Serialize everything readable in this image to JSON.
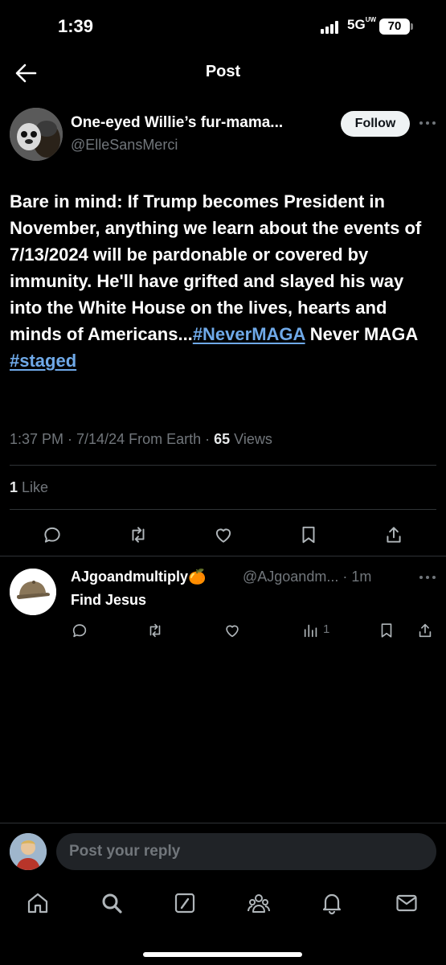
{
  "status_bar": {
    "time": "1:39",
    "network": "5G",
    "network_sup": "UW",
    "battery": "70"
  },
  "header": {
    "title": "Post"
  },
  "post": {
    "author_name": "One-eyed Willie’s fur-mama...",
    "author_handle": "@ElleSansMerci",
    "follow_label": "Follow",
    "text_main": "Bare in mind: If Trump becomes President in November, anything we learn about the events of 7/13/2024 will be pardonable or covered by immunity. He'll have grifted and slayed his way into the White House on the lives, hearts and minds of Americans...",
    "hashtag_1": "#NeverMAGA",
    "text_mid": " Never MAGA ",
    "hashtag_2": "#staged",
    "meta": "1:37 PM · 7/14/24 From Earth · ",
    "views_count": "65",
    "views_label": " Views",
    "likes_count": "1",
    "likes_label": " Like"
  },
  "reply": {
    "name": "AJgoandmultiply",
    "emoji": "🍊",
    "handle": "@AJgoandm... · 1m",
    "text": "Find Jesus",
    "views": "1"
  },
  "composer": {
    "placeholder": "Post your reply"
  },
  "icons": {
    "header": [
      "back-arrow-icon"
    ],
    "post_actions": [
      "reply-icon",
      "repost-icon",
      "like-icon",
      "bookmark-icon",
      "share-icon"
    ],
    "reply_actions": [
      "reply-icon",
      "repost-icon",
      "like-icon",
      "views-icon",
      "bookmark-icon",
      "share-icon"
    ],
    "nav": [
      "home-icon",
      "search-icon",
      "grok-icon",
      "communities-icon",
      "notifications-icon",
      "messages-icon"
    ]
  },
  "colors": {
    "background": "#000000",
    "text": "#e7e9ea",
    "muted": "#71767b",
    "link": "#6fa9e8",
    "divider": "#2f3336"
  }
}
